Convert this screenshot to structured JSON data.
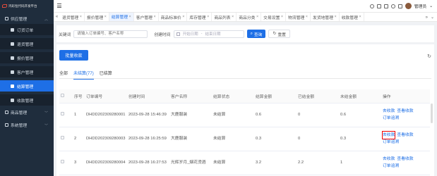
{
  "sidebar": {
    "logo": "鸿彩恒代码开发平台",
    "groups": [
      {
        "label": "供应管理",
        "icon": "supply-icon",
        "expanded": true
      },
      {
        "label": "商品管理",
        "icon": "goods-icon",
        "expanded": false
      },
      {
        "label": "系统管理",
        "icon": "system-icon",
        "expanded": false
      }
    ],
    "items": [
      {
        "label": "订货订单"
      },
      {
        "label": "退货管理"
      },
      {
        "label": "报价管理"
      },
      {
        "label": "客户管理"
      },
      {
        "label": "结算管理",
        "active": true
      },
      {
        "label": "收款管理"
      }
    ]
  },
  "header": {
    "user": "管理员"
  },
  "tabs": [
    "退货管理",
    "报价管理",
    "结算管理",
    "客户管理",
    "商品标准价",
    "库存管理",
    "商品列表",
    "商品分类",
    "交易设置",
    "物流管理",
    "发货地管理",
    "收款管理"
  ],
  "active_tab": "结算管理",
  "search": {
    "keyword_label": "关键词",
    "keyword_placeholder": "请输入订单编号、客户名称",
    "time_label": "创建时间",
    "start_placeholder": "开始日期",
    "separator": "-",
    "end_placeholder": "结束日期",
    "search_button": "查询",
    "reset_button": "重置"
  },
  "toolbar": {
    "batch_button": "批量收款"
  },
  "filter_tabs": [
    "全部",
    "未结算(77)",
    "已结算"
  ],
  "active_filter": "未结算(77)",
  "table": {
    "columns": [
      "序号",
      "订单编号",
      "创建时间",
      "客户名称",
      "结算状态",
      "结算金额",
      "已结金额",
      "未结金额",
      "操作"
    ],
    "rows": [
      {
        "no": "1",
        "order": "DHDD202309280001",
        "time": "2023-09-28 15:46:39",
        "customer": "大鹿服装",
        "status": "未结算",
        "amount": "0.6",
        "paid": "0",
        "unpaid": "0.6"
      },
      {
        "no": "2",
        "order": "DHDD202309280003",
        "time": "2023-09-28 16:25:59",
        "customer": "大鹿服装",
        "status": "未结算",
        "amount": "0.3",
        "paid": "0",
        "unpaid": "0.3"
      },
      {
        "no": "3",
        "order": "DHDD202309280004",
        "time": "2023-09-28 16:27:53",
        "customer": "光辉岁月_烟花烫酒",
        "status": "未结算",
        "amount": "3.2",
        "paid": "2.2",
        "unpaid": "1"
      }
    ],
    "actions": {
      "collect": "去收款",
      "view": "查看收款",
      "trace": "订单追溯"
    }
  }
}
